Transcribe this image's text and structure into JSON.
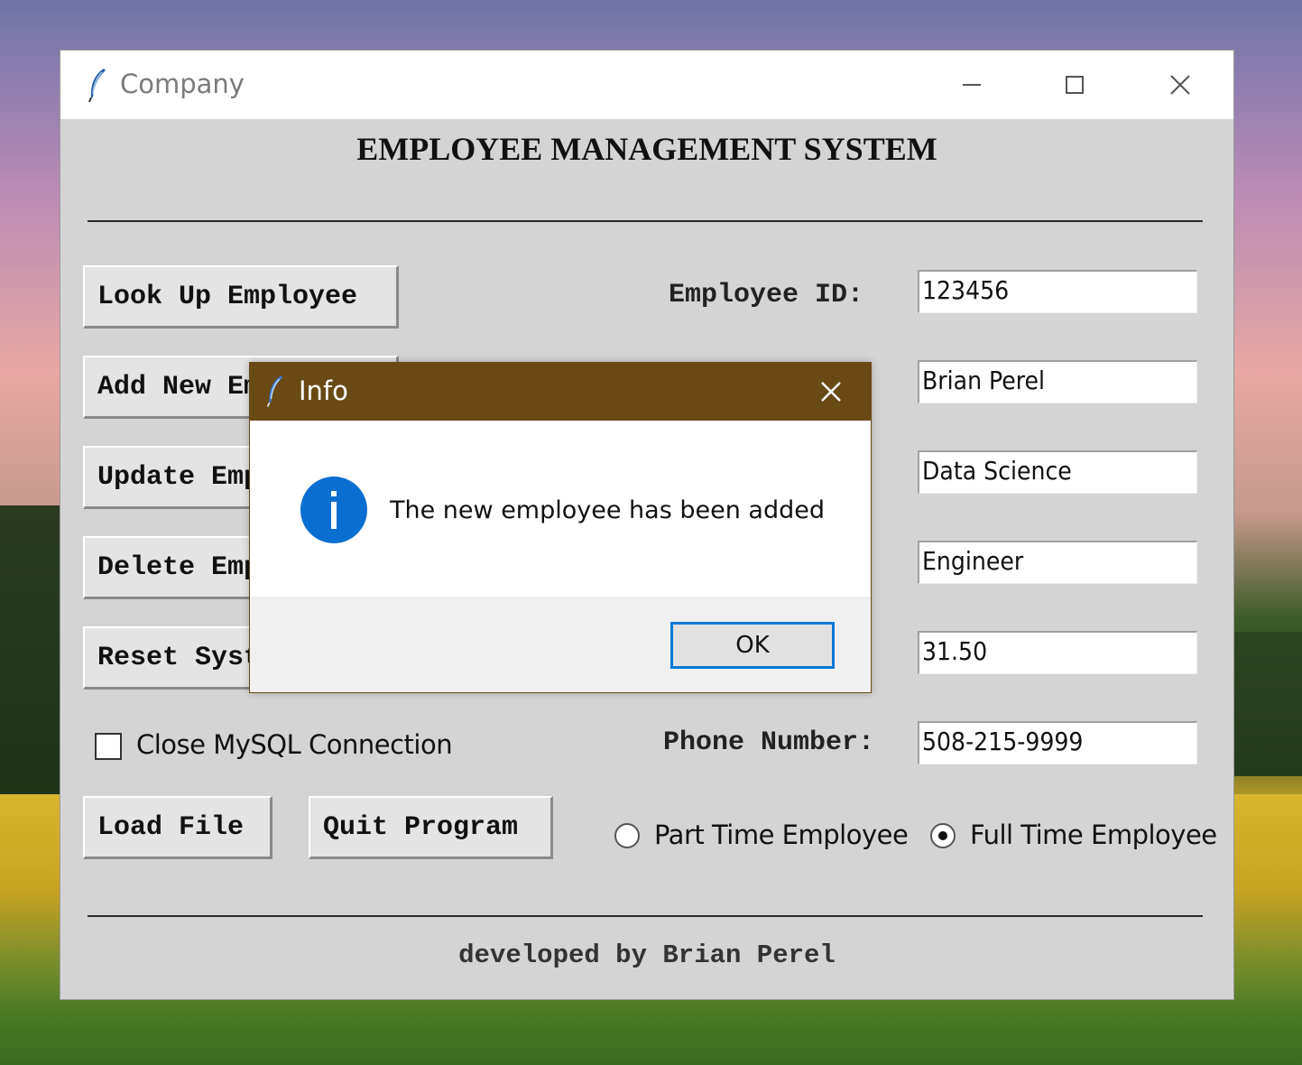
{
  "window": {
    "title": "Company",
    "feather_icon": "tk-feather-icon"
  },
  "heading": "EMPLOYEE MANAGEMENT SYSTEM",
  "buttons": {
    "lookup": "Look Up Employee",
    "add": "Add New Employee",
    "update": "Update Employee",
    "delete": "Delete Employee",
    "reset": "Reset System",
    "load": "Load File",
    "quit": "Quit Program"
  },
  "fields": {
    "id_label": "Employee ID:",
    "id_value": "123456",
    "name_value": "Brian Perel",
    "dept_value": "Data Science",
    "title_value": "Engineer",
    "pay_value": "31.50",
    "phone_label": "Phone Number:",
    "phone_value": "508-215-9999"
  },
  "checkbox": {
    "label": "Close MySQL Connection",
    "checked": false
  },
  "radios": {
    "part_time": "Part Time Employee",
    "full_time": "Full Time Employee",
    "selected": "full_time"
  },
  "footer": "developed by Brian Perel",
  "dialog": {
    "title": "Info",
    "message": "The new employee has been added",
    "ok_label": "OK",
    "icon": "info-icon",
    "colors": {
      "titlebar": "#6a4a14",
      "icon": "#0a6fd0",
      "ok_border": "#0a78d7"
    }
  }
}
